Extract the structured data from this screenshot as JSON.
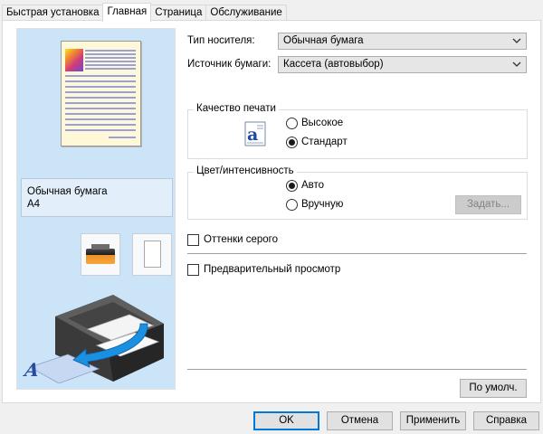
{
  "tabs": [
    {
      "label": "Быстрая установка",
      "active": false
    },
    {
      "label": "Главная",
      "active": true
    },
    {
      "label": "Страница",
      "active": false
    },
    {
      "label": "Обслуживание",
      "active": false
    }
  ],
  "preview": {
    "media_name": "Обычная бумага",
    "paper_size": "A4"
  },
  "media_type": {
    "label": "Тип носителя:",
    "value": "Обычная бумага"
  },
  "paper_source": {
    "label": "Источник бумаги:",
    "value": "Кассета (автовыбор)"
  },
  "print_quality": {
    "title": "Качество печати",
    "options": [
      {
        "label": "Высокое",
        "selected": false
      },
      {
        "label": "Стандарт",
        "selected": true
      }
    ]
  },
  "color_intensity": {
    "title": "Цвет/интенсивность",
    "options": [
      {
        "label": "Авто",
        "selected": true
      },
      {
        "label": "Вручную",
        "selected": false
      }
    ],
    "set_button": "Задать..."
  },
  "grayscale": {
    "label": "Оттенки серого",
    "checked": false
  },
  "preview_option": {
    "label": "Предварительный просмотр",
    "checked": false
  },
  "defaults_button": "По умолч.",
  "footer": {
    "ok": "OK",
    "cancel": "Отмена",
    "apply": "Применить",
    "help": "Справка"
  },
  "colors": {
    "preview_bg": "#cce4f7",
    "default_button_border": "#0078d7"
  }
}
